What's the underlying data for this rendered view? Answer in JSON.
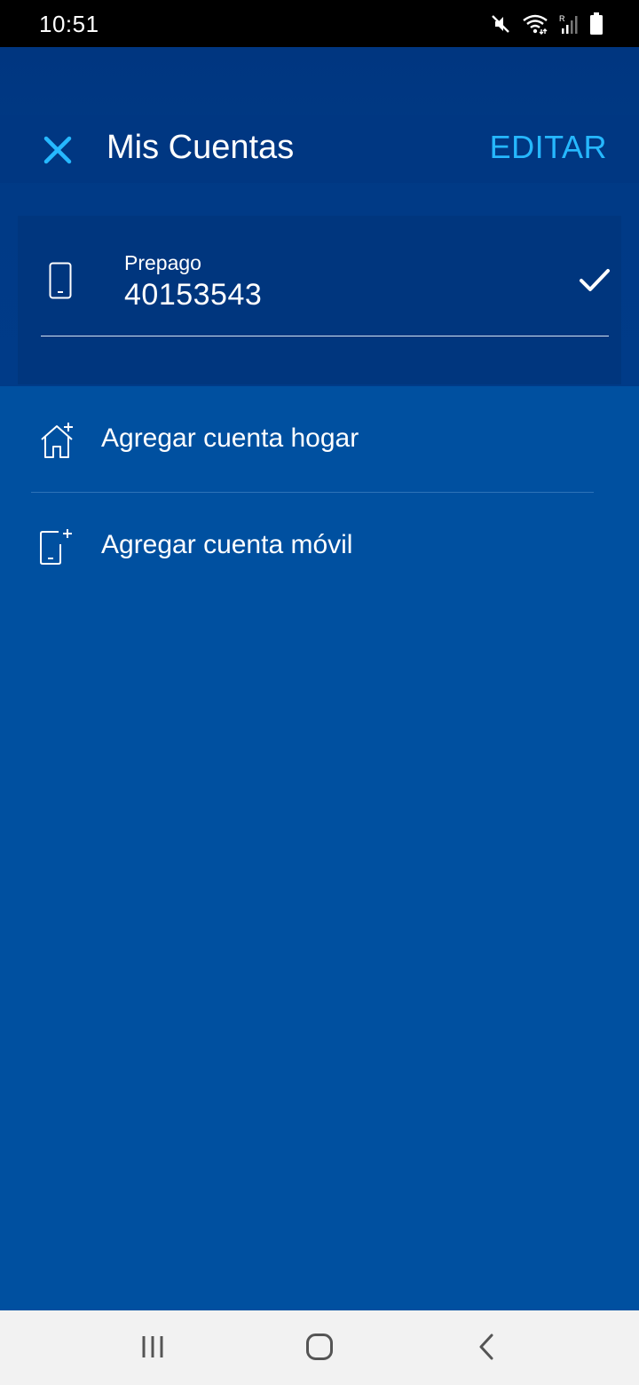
{
  "status_bar": {
    "time": "10:51",
    "icons": [
      "mute-icon",
      "wifi-icon",
      "signal-icon",
      "battery-icon"
    ]
  },
  "toolbar": {
    "title": "Mis Cuentas",
    "edit_label": "EDITAR",
    "close_icon": "close-icon"
  },
  "account": {
    "type": "Prepago",
    "number": "40153543",
    "icon": "phone-icon",
    "selected_icon": "check-icon"
  },
  "actions": [
    {
      "label": "Agregar cuenta hogar",
      "icon": "add-home-icon"
    },
    {
      "label": "Agregar cuenta móvil",
      "icon": "add-mobile-icon"
    }
  ],
  "nav_bar": {
    "buttons": [
      "recent-apps-icon",
      "home-icon",
      "back-icon"
    ]
  },
  "colors": {
    "background": "#0050a0",
    "header": "#003782",
    "accent": "#26b8ff",
    "text": "#ffffff"
  }
}
